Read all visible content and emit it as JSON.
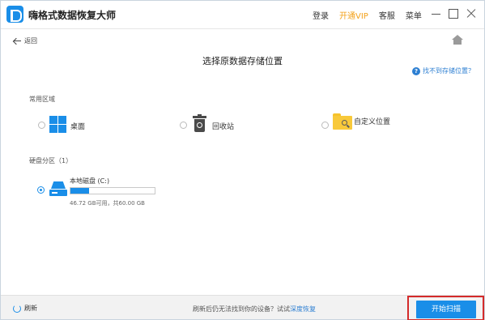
{
  "app": {
    "title": "嗨格式数据恢复大师",
    "icon": "app-logo-icon"
  },
  "menu": {
    "login": "登录",
    "vip": "开通VIP",
    "service": "客服",
    "menu": "菜单"
  },
  "colors": {
    "accent": "#1a8ee8",
    "vip": "#f3a21b",
    "highlight": "#d42a2a"
  },
  "nav": {
    "back_label": "返回",
    "home_icon": "home-icon"
  },
  "page": {
    "title": "选择原数据存储位置",
    "help_label": "找不到存储位置？"
  },
  "common_area": {
    "label": "常用区域",
    "options": [
      {
        "label": "桌面",
        "icon": "windows-icon",
        "selected": false
      },
      {
        "label": "回收站",
        "icon": "recycle-bin-icon",
        "selected": false
      },
      {
        "label": "自定义位置",
        "icon": "folder-search-icon",
        "selected": false
      }
    ]
  },
  "partitions": {
    "label": "硬盘分区（1）",
    "disks": [
      {
        "name": "本地磁盘 (C:)",
        "info": "46.72 GB可用，共60.00 GB",
        "used_fraction": 0.22,
        "selected": true,
        "icon": "disk-icon"
      }
    ]
  },
  "footer": {
    "refresh_label": "刷新",
    "message_prefix": "刷新后仍无法找到你的设备？试试",
    "message_link": "深度恢复",
    "start_label": "开始扫描"
  }
}
